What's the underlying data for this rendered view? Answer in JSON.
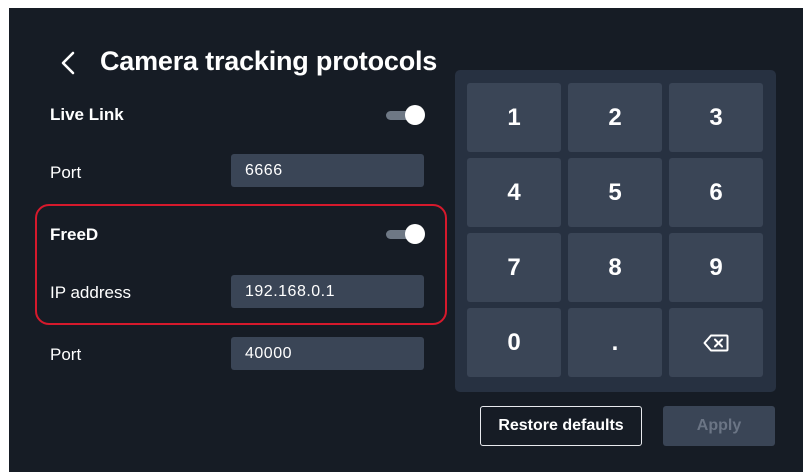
{
  "header": {
    "title": "Camera tracking protocols"
  },
  "live_link": {
    "label": "Live Link",
    "enabled": true,
    "port_label": "Port",
    "port_value": "6666"
  },
  "freed": {
    "label": "FreeD",
    "enabled": true,
    "ip_label": "IP address",
    "ip_value": "192.168.0.1",
    "port_label": "Port",
    "port_value": "40000"
  },
  "keypad": {
    "keys": [
      "1",
      "2",
      "3",
      "4",
      "5",
      "6",
      "7",
      "8",
      "9",
      "0",
      "."
    ],
    "backspace_icon": "backspace-icon"
  },
  "actions": {
    "restore_label": "Restore defaults",
    "apply_label": "Apply"
  },
  "colors": {
    "background": "#161c25",
    "panel": "#273141",
    "key": "#3a4556",
    "highlight": "#d6192c"
  }
}
